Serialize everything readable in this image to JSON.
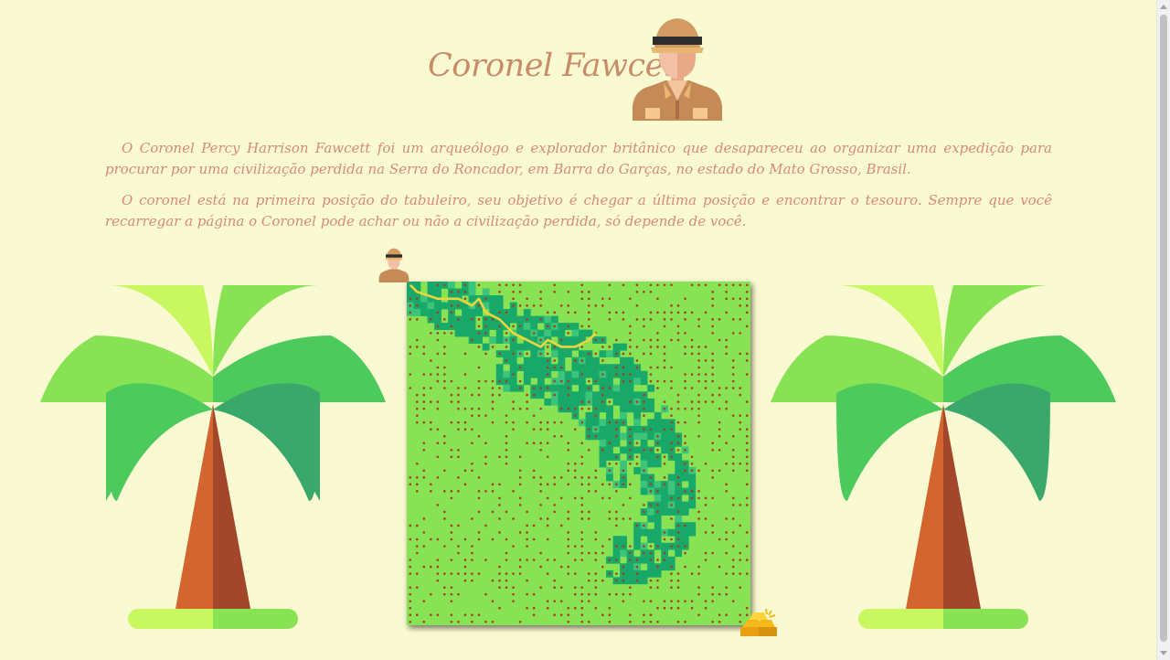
{
  "header": {
    "title": "Coronel Fawcett",
    "hero_icon": "explorer-avatar-icon"
  },
  "intro": {
    "paragraph_1": "O Coronel Percy Harrison Fawcett foi um arqueólogo e explorador britânico que desapareceu ao organizar uma expedição para procurar por uma civilização perdida na Serra do Roncador, em Barra do Garças, no estado do Mato Grosso, Brasil.",
    "paragraph_2": "O coronel está na primeira posição do tabuleiro, seu objetivo é chegar a última posição e encontrar o tesouro. Sempre que você recarregar a página o Coronel pode achar ou não a civilização perdida, só depende de você."
  },
  "board": {
    "cells_per_side": 50,
    "start_label": "player",
    "goal_label": "treasure",
    "colors": {
      "grass": "#88e354",
      "jungle": "#18a86a",
      "jungle_light": "#3cc47a",
      "dot": "#a53e1f",
      "path": "#f0d43c"
    }
  },
  "decor": {
    "left_icon": "palm-tree-icon",
    "right_icon": "palm-tree-icon",
    "player_icon": "explorer-piece-icon",
    "goal_icon": "gold-bars-icon"
  }
}
